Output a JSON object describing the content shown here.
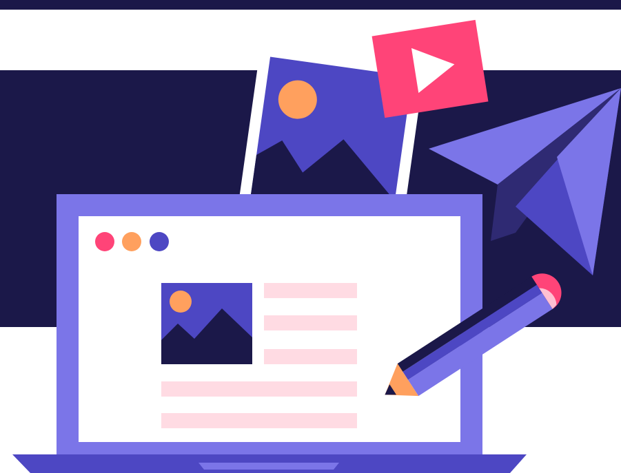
{
  "illustration": {
    "subject": "laptop-with-media-icons",
    "icons": [
      "photo-icon",
      "play-video-icon",
      "paper-plane-icon",
      "pencil-icon",
      "laptop-icon"
    ],
    "colors": {
      "navy": "#1b1849",
      "violet": "#7b75e8",
      "indigo": "#4d47c3",
      "white": "#ffffff",
      "pink_red": "#ff4478",
      "orange": "#ffa05e",
      "light_pink": "#ffdbe3"
    },
    "window_dots": [
      "pink_red",
      "orange",
      "indigo"
    ]
  }
}
